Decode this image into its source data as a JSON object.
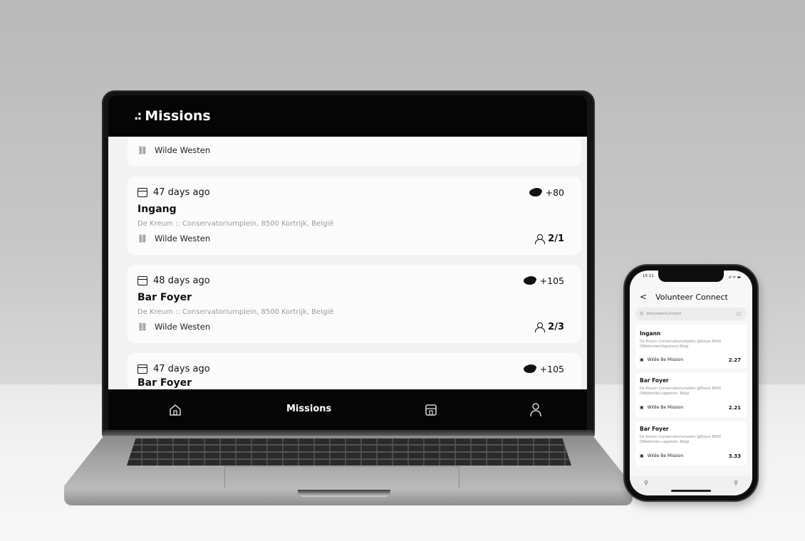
{
  "laptop": {
    "header": {
      "logo": ".:",
      "title": "Missions"
    },
    "partial_top_card": {
      "organization": "Wilde Westen"
    },
    "missions": [
      {
        "time_ago": "47 days ago",
        "reward": "+80",
        "title": "Ingang",
        "address": "De Kreum :: Conservatoriumplein, 8500 Kortrijk, België",
        "organization": "Wilde Westen",
        "participants": "2/1"
      },
      {
        "time_ago": "48 days ago",
        "reward": "+105",
        "title": "Bar Foyer",
        "address": "De Kreum :: Conservatoriumplein, 8500 Kortrijk, België",
        "organization": "Wilde Westen",
        "participants": "2/3"
      },
      {
        "time_ago": "47 days ago",
        "reward": "+105",
        "title": "Bar Foyer"
      }
    ],
    "tabbar": {
      "home_icon": "home-icon",
      "active_label": "Missions",
      "store_icon": "store-icon",
      "profile_icon": "user-icon"
    }
  },
  "phone": {
    "status_time": "15:11",
    "status_icons": ".ıl ᯤ ▬",
    "header": {
      "back": "<",
      "title": "Volunteer Connect"
    },
    "search": {
      "placeholder": "VolunteerConnect"
    },
    "missions": [
      {
        "title": "Ingann",
        "address": "De Kreum Conservatoriumplein @Kreun 8500 OWetemlenUsgoinout Belgi.",
        "organization": "Wilde Be Mission",
        "value": "2.27"
      },
      {
        "title": "Bar Foyer",
        "address": "De Kreum Conservatoriumplein @Kreun 8500 OWetemlen.sagoinon. Belgi.",
        "organization": "Wilde Be Mission",
        "value": "2.21"
      },
      {
        "title": "Bar Foyer",
        "address": "De Kreum Conservatoriumplein @Kreun 8500 OWetemlen.sagoinon. Belgi.",
        "organization": "Wilde Be Mission",
        "value": "3.33"
      }
    ]
  }
}
